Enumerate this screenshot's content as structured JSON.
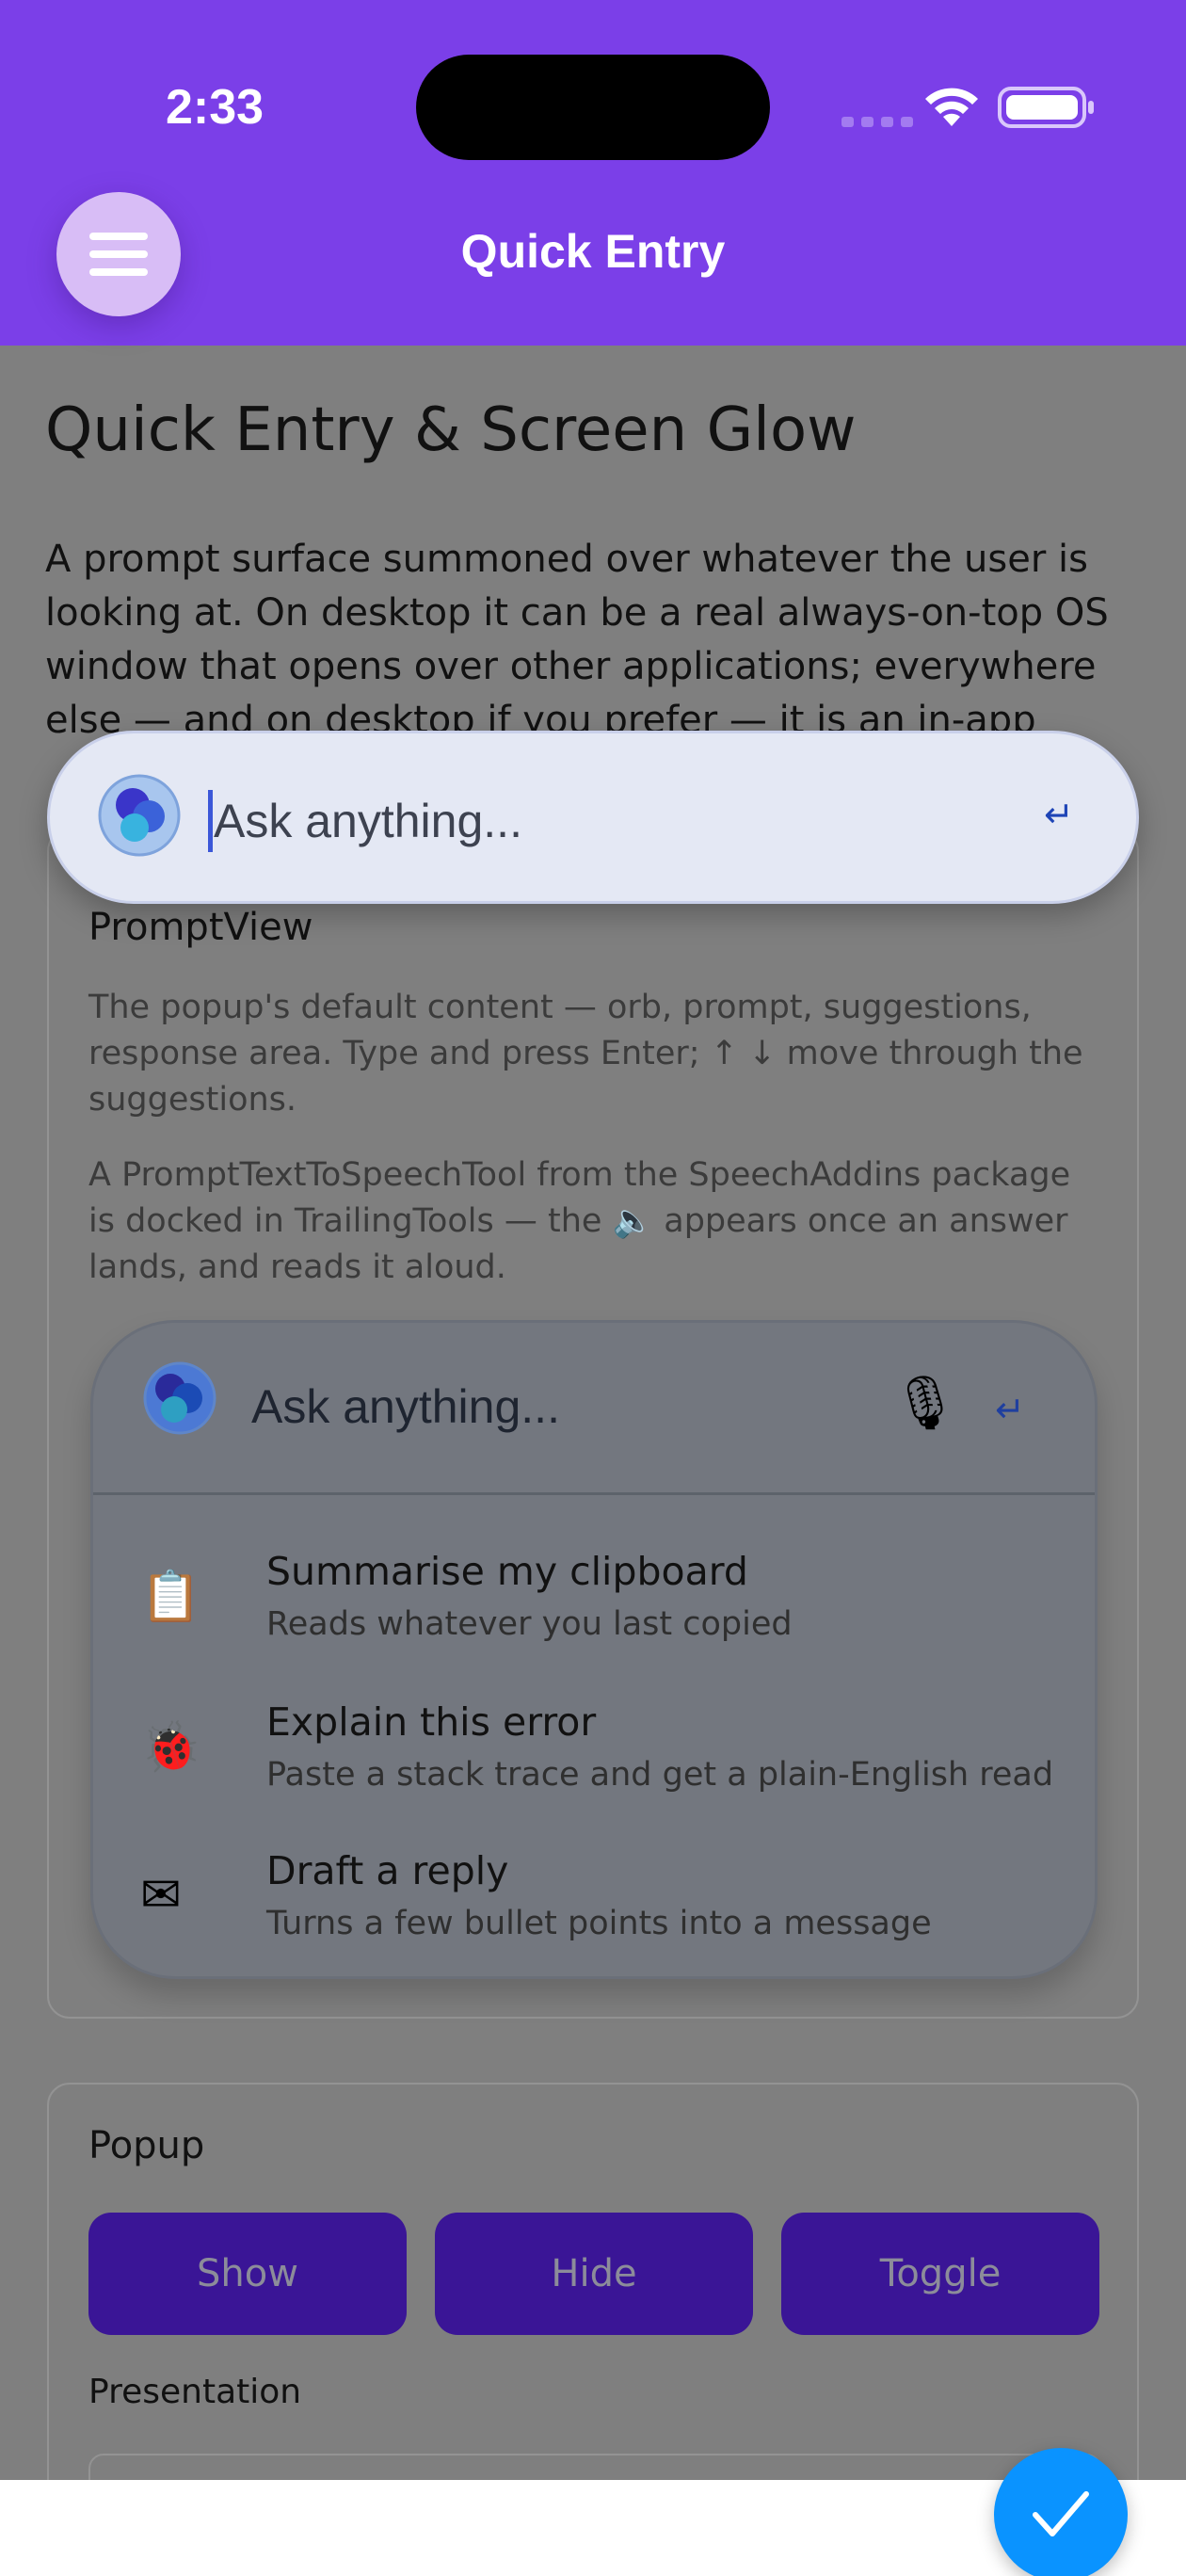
{
  "status_bar": {
    "time": "2:33"
  },
  "header": {
    "title": "Quick Entry"
  },
  "main": {
    "page_title": "Quick Entry & Screen Glow",
    "intro": "A prompt surface summoned over whatever the user is looking at. On desktop it can be a real always-on-top OS window that opens over other applications; everywhere else — and on desktop if you prefer — it is an in-app"
  },
  "prompt_view_card": {
    "title": "PromptView",
    "desc1": "The popup's default content — orb, prompt, suggestions, response area. Type and press Enter; ↑ ↓ move through the suggestions.",
    "desc2": "A PromptTextToSpeechTool from the SpeechAddins package is docked in TrailingTools — the 🔈 appears once an answer lands, and reads it aloud.",
    "preview": {
      "input_text": "Ask anything...",
      "enter_glyph": "↵",
      "mic_glyph": "🎙",
      "suggestions": [
        {
          "icon": "📋",
          "title": "Summarise my clipboard",
          "subtitle": "Reads whatever you last copied"
        },
        {
          "icon": "🐞",
          "title": "Explain this error",
          "subtitle": "Paste a stack trace and get a plain-English read"
        },
        {
          "icon": "✉",
          "title": "Draft a reply",
          "subtitle": "Turns a few bullet points into a message"
        }
      ]
    }
  },
  "popup_card": {
    "title": "Popup",
    "buttons": {
      "show": "Show",
      "hide": "Hide",
      "toggle": "Toggle"
    },
    "presentation_label": "Presentation"
  },
  "quick_entry": {
    "placeholder": "Ask anything...",
    "enter_glyph": "↵"
  },
  "colors": {
    "header": "#7b3fe8",
    "popup_button": "#3a1596",
    "fab": "#0a93ff"
  }
}
